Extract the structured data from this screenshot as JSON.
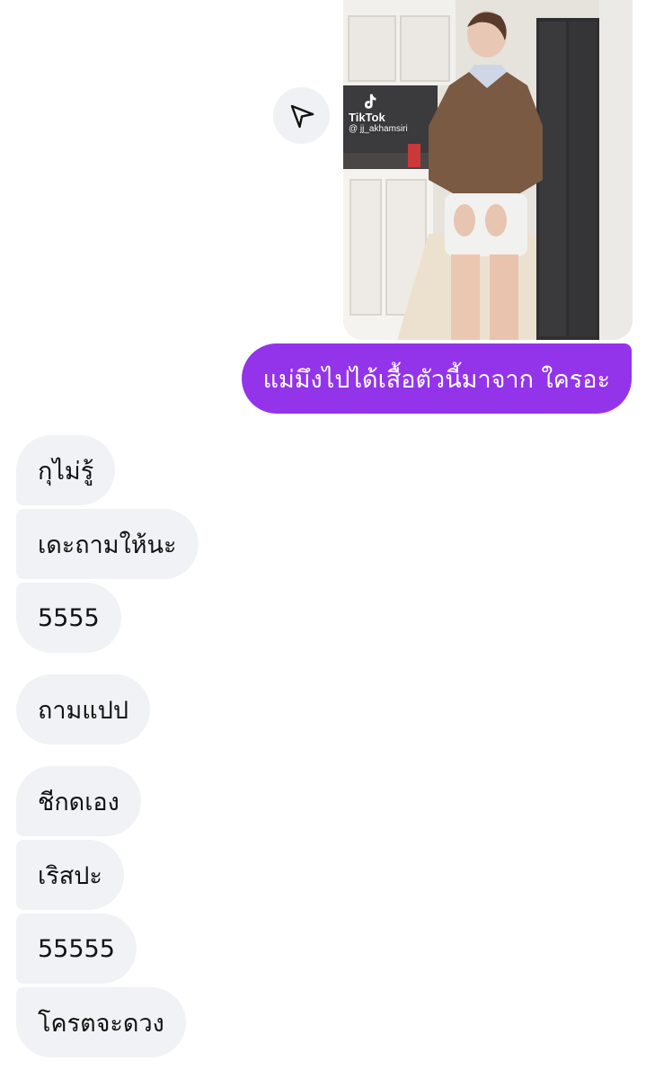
{
  "thread": {
    "sent": {
      "media": {
        "watermark_brand": "TikTok",
        "watermark_user": "@ jj_akhamsiri"
      },
      "message": "แม่มึงไปได้เสื้อตัวนี้มาจาก ใครอะ",
      "share_icon": "paper-plane-icon"
    },
    "received": [
      {
        "text": "กุไม่รู้"
      },
      {
        "text": "เดะถามให้นะ"
      },
      {
        "text": "5555"
      },
      {
        "text": "ถามแปป"
      },
      {
        "text": "ชีกดเอง"
      },
      {
        "text": "เริสปะ"
      },
      {
        "text": "55555"
      },
      {
        "text": "โครตจะดวง"
      }
    ]
  },
  "colors": {
    "sent_bubble": "#9333ea",
    "received_bubble": "#f1f2f5",
    "share_button": "#f0f1f4"
  }
}
